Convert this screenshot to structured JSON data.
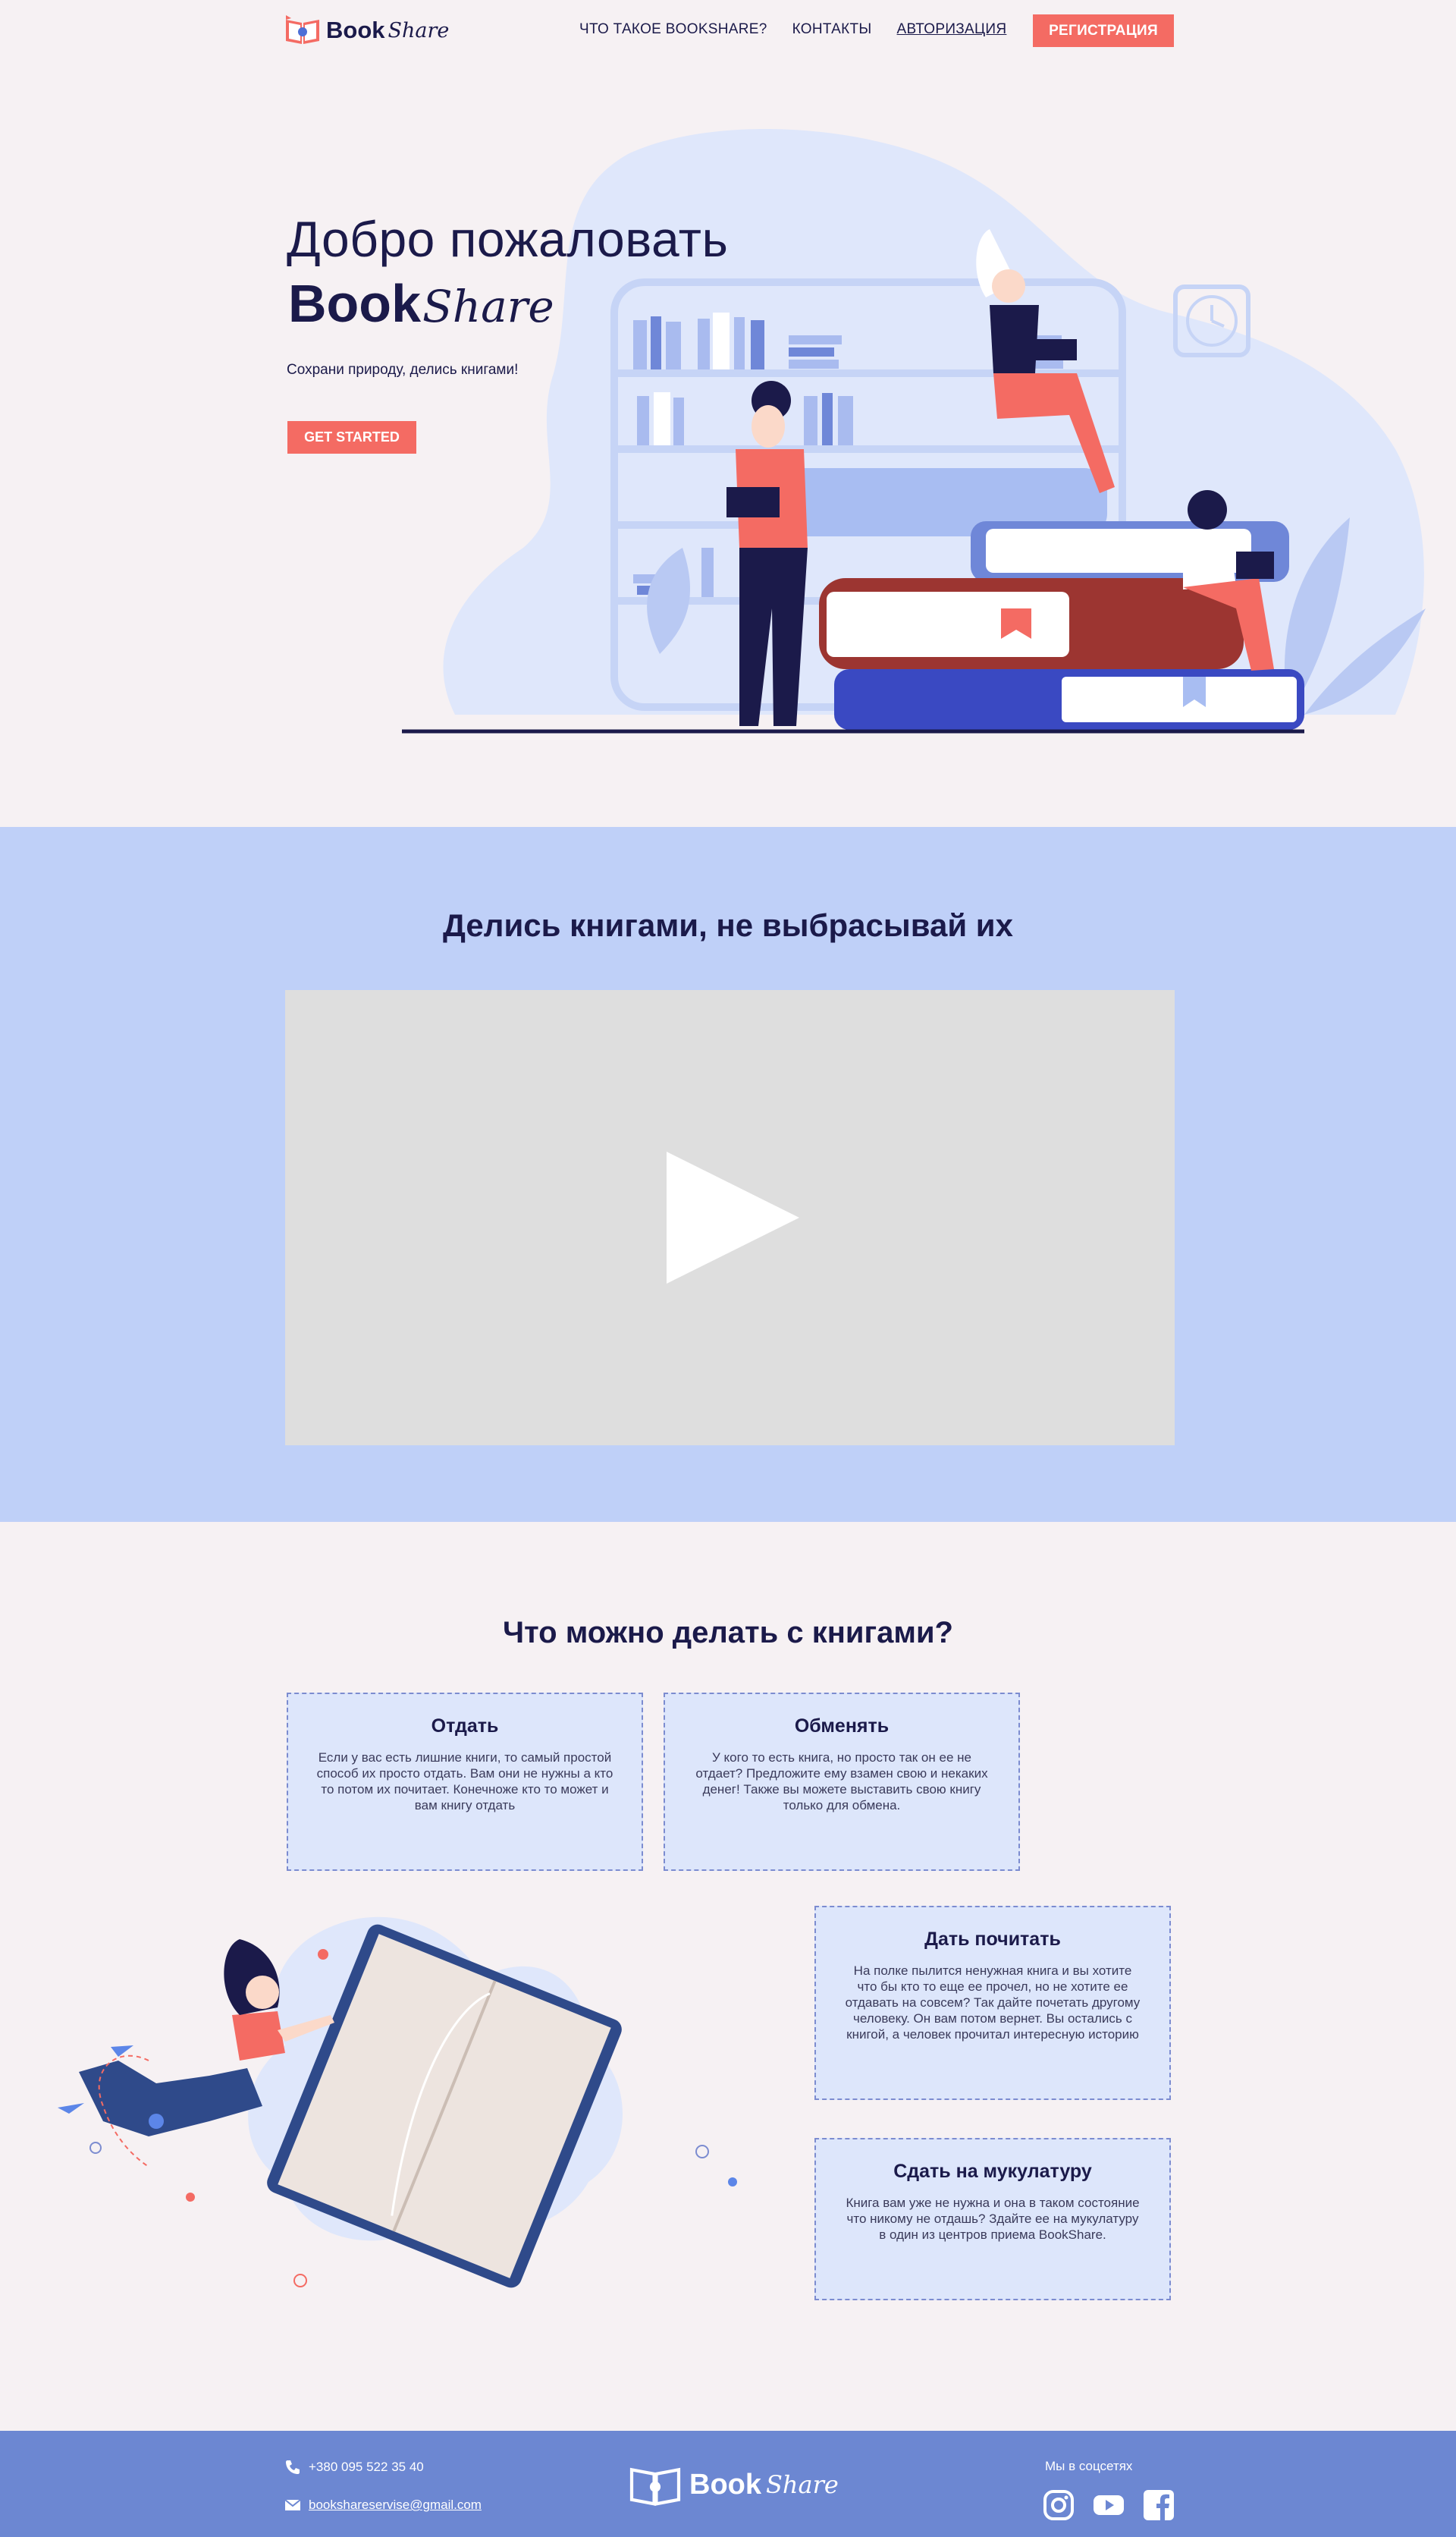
{
  "header": {
    "logo_book": "Book",
    "logo_share": "Share",
    "nav": [
      "ЧТО ТАКОЕ BOOKSHARE?",
      "КОНТАКТЫ",
      "АВТОРИЗАЦИЯ"
    ],
    "register_label": "РЕГИСТРАЦИЯ"
  },
  "hero": {
    "title": "Добро пожаловать",
    "brand_book": "Book",
    "brand_share": "Share",
    "subtitle": "Сохрани природу, делись книгами!",
    "cta_label": "GET STARTED"
  },
  "video": {
    "title": "Делись книгами, не выбрасывай их"
  },
  "features": {
    "title": "Что можно делать с книгами?",
    "cards": [
      {
        "title": "Отдать",
        "text": "Если у вас есть лишние книги, то самый простой способ их просто отдать. Вам они не нужны а кто то потом их почитает. Конечножe кто то может и вам книгу отдать"
      },
      {
        "title": "Обменять",
        "text": "У кого то есть книга, но просто так он ее не отдает?   Предложите ему взамен свою и некаких денег!  Также вы можете выставить свою книгу только для обмена."
      },
      {
        "title": "Дать почитать",
        "text": "На полке пылится ненужная книга и вы хотите что бы кто то еще ее прочел, но не хотите ее отдавать на совсем? Так дайте почетать другому человеку. Он вам потом вернет.  Вы остались с книгой, а человек прочитал интересную историю"
      },
      {
        "title": "Сдать на мукулатуру",
        "text": "Книга вам уже не нужна и она в таком состояние что никому не отдашь? Здайте ее на мукулатуру в один из центров приема BookShare."
      }
    ]
  },
  "footer": {
    "phone": "+380 095 522 35 40",
    "email": "bookshareservise@gmail.com",
    "logo_book": "Book",
    "logo_share": "Share",
    "social_label": "Мы в соцсетях",
    "social_icons": [
      "instagram-icon",
      "youtube-icon",
      "facebook-icon"
    ]
  },
  "colors": {
    "accent": "#f46b63",
    "navy": "#1b1a4a",
    "video_bg": "#bfd0f8",
    "card_bg": "#dde6fb",
    "footer_bg": "#6c87d2"
  }
}
